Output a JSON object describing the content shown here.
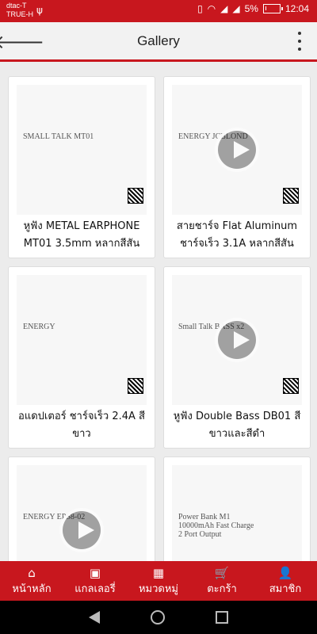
{
  "status_bar": {
    "carrier_1": "dtac-T",
    "carrier_2": "TRUE-H",
    "battery_percent": "5%",
    "battery_level": 0.05,
    "time": "12:04"
  },
  "header": {
    "title": "Gallery"
  },
  "gallery": [
    {
      "title": "หูฟัง METAL EARPHONE MT01 3.5mm หลากสีสัน",
      "has_video": false,
      "image_caption": "SMALL TALK MT01"
    },
    {
      "title": "สายชาร์จ Flat Aluminum ชาร์จเร็ว 3.1A หลากสีสัน",
      "has_video": true,
      "image_caption": "ENERGY JCBLOND"
    },
    {
      "title": "อแดปเตอร์ ชาร์จเร็ว 2.4A สีขาว",
      "has_video": false,
      "image_caption": "ENERGY"
    },
    {
      "title": "หูฟัง Double Bass DB01 สีขาวและสีดำ",
      "has_video": true,
      "image_caption": "Small Talk BASS x2"
    },
    {
      "title": "",
      "has_video": true,
      "image_caption": "ENERGY EPS8-02"
    },
    {
      "title": "",
      "has_video": false,
      "image_caption": "Power Bank M1 10000mAh Fast Charge 2 Port Output"
    }
  ],
  "bottom_nav": [
    {
      "label": "หน้าหลัก",
      "icon": "home-icon",
      "glyph": "⌂"
    },
    {
      "label": "แกลเลอรี่",
      "icon": "image-icon",
      "glyph": "▣"
    },
    {
      "label": "หมวดหมู่",
      "icon": "grid-icon",
      "glyph": "▦"
    },
    {
      "label": "ตะกร้า",
      "icon": "cart-icon",
      "glyph": "🛒"
    },
    {
      "label": "สมาชิก",
      "icon": "user-icon",
      "glyph": "👤"
    }
  ],
  "colors": {
    "brand_red": "#c8171e",
    "app_bar_bg": "#f2f2f2"
  }
}
